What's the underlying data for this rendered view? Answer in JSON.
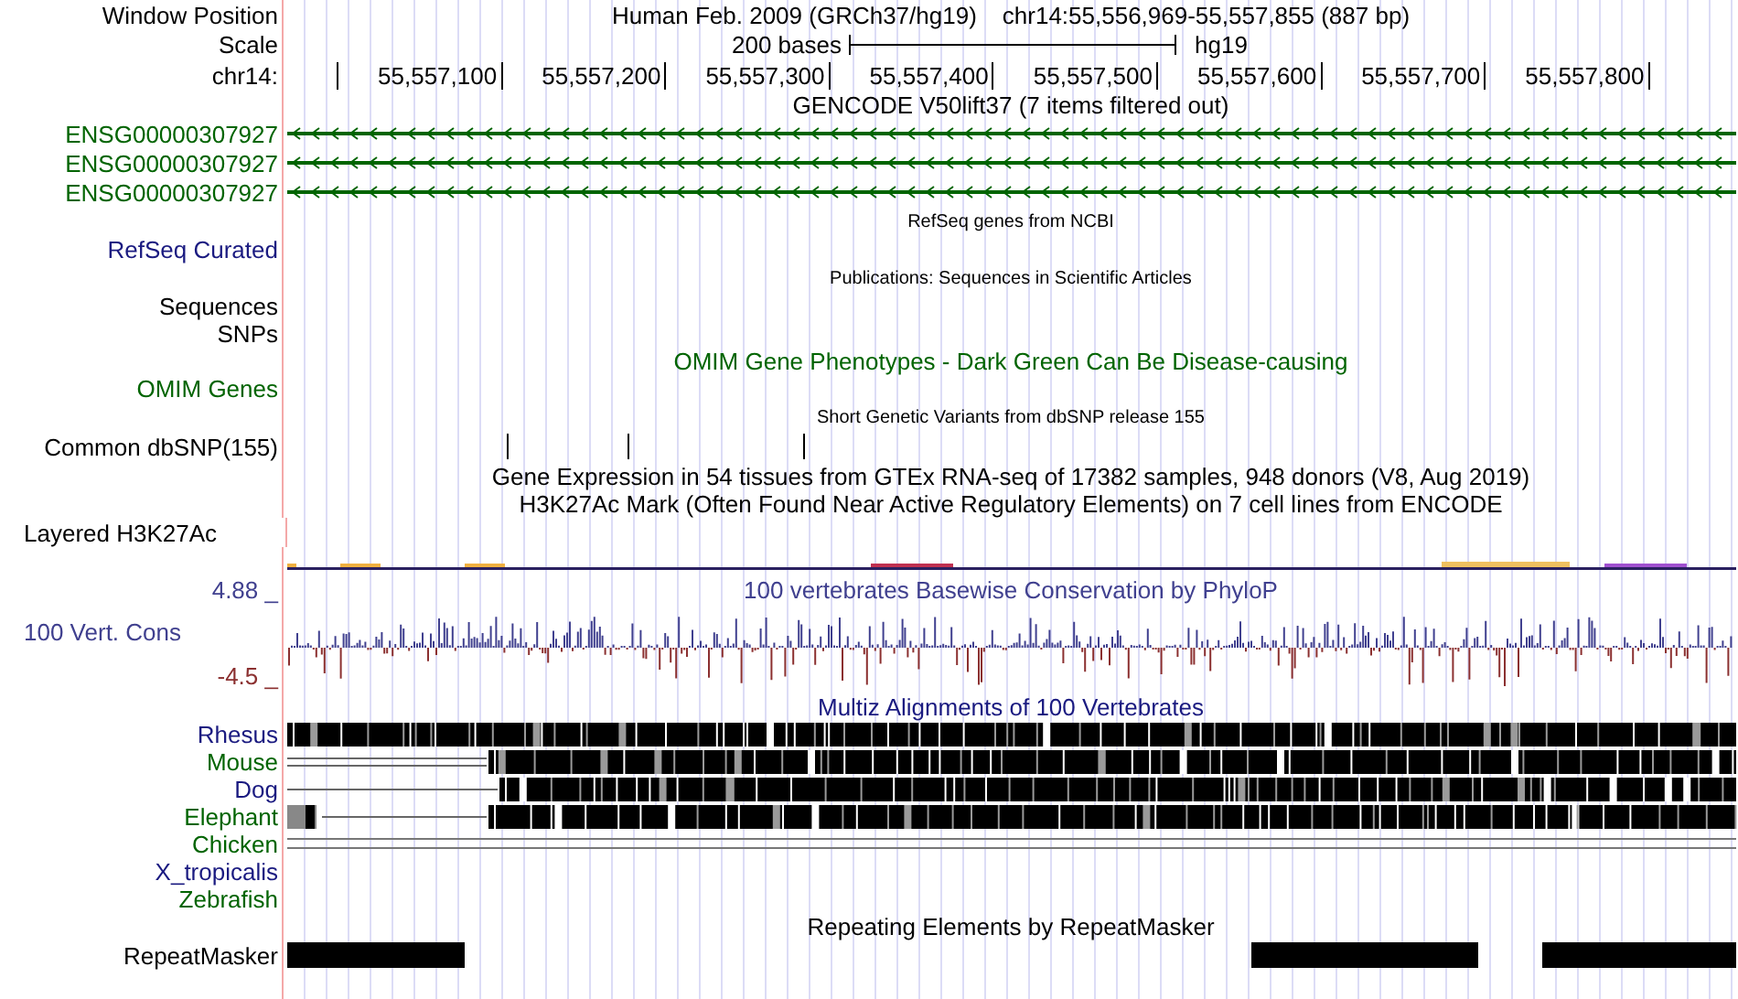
{
  "header": {
    "label": "Window Position",
    "assembly": "Human Feb. 2009 (GRCh37/hg19)",
    "position": "chr14:55,556,969-55,557,855 (887 bp)"
  },
  "scale": {
    "label": "Scale",
    "bar_label": "200 bases",
    "assembly": "hg19"
  },
  "ruler": {
    "label": "chr14:",
    "ticks": [
      "55,557,100",
      "55,557,200",
      "55,557,300",
      "55,557,400",
      "55,557,500",
      "55,557,600",
      "55,557,700",
      "55,557,800"
    ]
  },
  "tracks": [
    {
      "kind": "title",
      "text": "GENCODE V50lift37 (7 items filtered out)",
      "color": "#000000"
    },
    {
      "kind": "gene",
      "label": "ENSG00000307927",
      "color": "#006400"
    },
    {
      "kind": "gene",
      "label": "ENSG00000307927",
      "color": "#006400"
    },
    {
      "kind": "gene",
      "label": "ENSG00000307927",
      "color": "#006400"
    },
    {
      "kind": "small_title",
      "text": "RefSeq genes from NCBI",
      "color": "#000000"
    },
    {
      "kind": "label",
      "label": "RefSeq Curated",
      "color": "#1a1a80"
    },
    {
      "kind": "small_title",
      "text": "Publications: Sequences in Scientific Articles",
      "color": "#000000"
    },
    {
      "kind": "label",
      "label": "Sequences",
      "color": "#000000"
    },
    {
      "kind": "label",
      "label": "SNPs",
      "color": "#000000"
    },
    {
      "kind": "title",
      "text": "OMIM Gene Phenotypes - Dark Green Can Be Disease-causing",
      "color": "#006400"
    },
    {
      "kind": "label",
      "label": "OMIM Genes",
      "color": "#006400"
    },
    {
      "kind": "small_title",
      "text": "Short Genetic Variants from dbSNP release 155",
      "color": "#000000"
    },
    {
      "kind": "snp",
      "label": "Common dbSNP(155)",
      "color": "#000000"
    },
    {
      "kind": "title",
      "text": "Gene Expression in 54 tissues from GTEx RNA-seq of 17382 samples, 948 donors (V8, Aug 2019)",
      "color": "#000000"
    },
    {
      "kind": "title",
      "text": "H3K27Ac Mark (Often Found Near Active Regulatory Elements) on 7 cell lines from ENCODE",
      "color": "#000000"
    },
    {
      "kind": "label_left",
      "label": "Layered H3K27Ac",
      "color": "#000000"
    },
    {
      "kind": "signal"
    },
    {
      "kind": "wiggle",
      "title": "100 vertebrates Basewise Conservation by PhyloP",
      "max": "4.88 _",
      "label": "100 Vert. Cons",
      "min": "-4.5 _",
      "color": "#40408f"
    },
    {
      "kind": "alignment",
      "title": "Multiz Alignments of 100 Vertebrates",
      "color": "#1a1a80",
      "species": [
        {
          "label": "Rhesus",
          "color": "#1a1a80",
          "kind": "full"
        },
        {
          "label": "Mouse",
          "color": "#006400",
          "kind": "partial_double"
        },
        {
          "label": "Dog",
          "color": "#1a1a80",
          "kind": "partial"
        },
        {
          "label": "Elephant",
          "color": "#006400",
          "kind": "partial_lead"
        },
        {
          "label": "Chicken",
          "color": "#006400",
          "kind": "lines"
        },
        {
          "label": "X_tropicalis",
          "color": "#1a1a80",
          "kind": "none"
        },
        {
          "label": "Zebrafish",
          "color": "#006400",
          "kind": "none"
        }
      ]
    },
    {
      "kind": "title",
      "text": "Repeating Elements by RepeatMasker",
      "color": "#000000"
    },
    {
      "kind": "repeats",
      "label": "RepeatMasker",
      "color": "#000000"
    }
  ]
}
